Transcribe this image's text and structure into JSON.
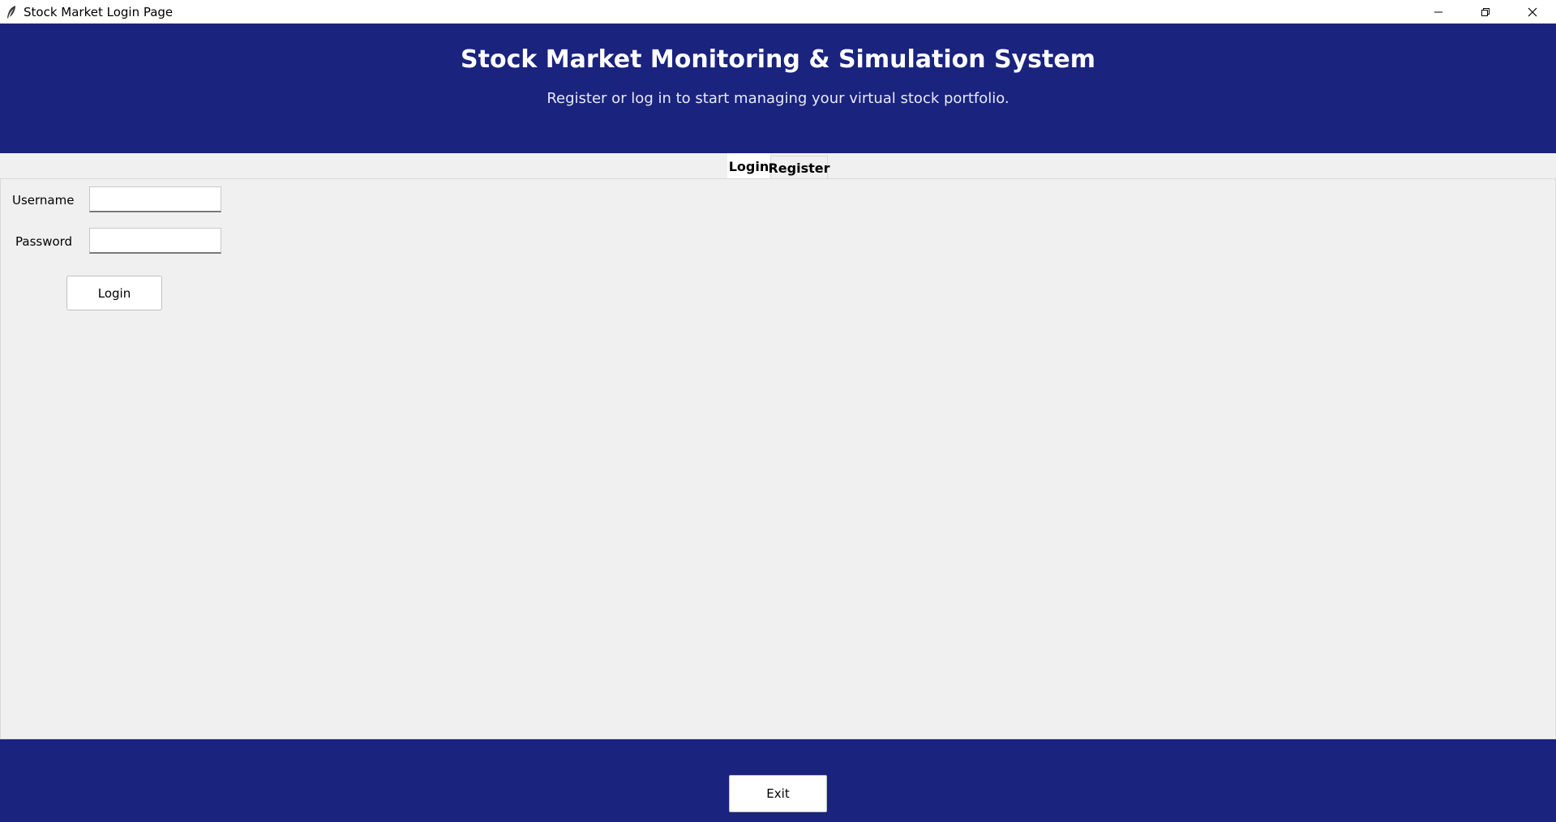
{
  "window": {
    "title": "Stock Market Login Page",
    "app_icon": "feather-icon",
    "controls": [
      "minimize-icon",
      "restore-icon",
      "close-icon"
    ]
  },
  "header": {
    "title": "Stock Market Monitoring & Simulation System",
    "subtitle": "Register or log in to start managing your virtual stock portfolio.",
    "background_color": "#1a237e"
  },
  "tabs": [
    {
      "label": "Login",
      "active": true
    },
    {
      "label": "Register",
      "active": false
    }
  ],
  "login_form": {
    "username_label": "Username",
    "username_value": "",
    "password_label": "Password",
    "password_value": "",
    "submit_label": "Login"
  },
  "footer": {
    "exit_label": "Exit",
    "background_color": "#1a237e"
  }
}
